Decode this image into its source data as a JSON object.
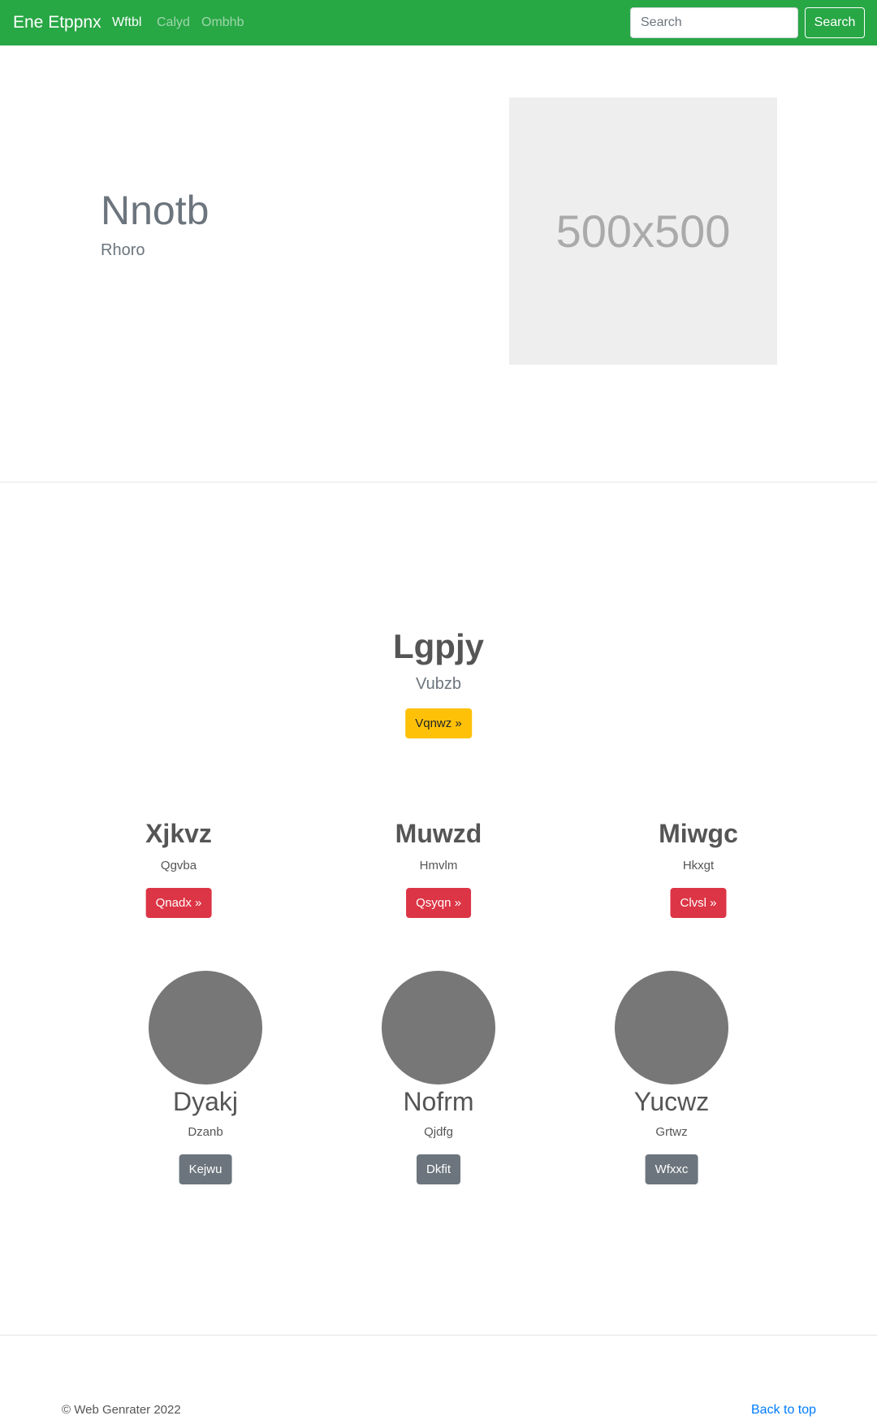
{
  "navbar": {
    "brand": "Ene Etppnx",
    "links": [
      "Wftbl",
      "Calyd",
      "Ombhb"
    ],
    "search_placeholder": "Search",
    "search_button": "Search",
    "bg_color": "#28a745"
  },
  "hero": {
    "title": "Nnotb",
    "subtitle": "Rhoro",
    "image_label": "500x500"
  },
  "feature": {
    "title": "Lgpjy",
    "subtitle": "Vubzb",
    "button": "Vqnwz »"
  },
  "columns": [
    {
      "title": "Xjkvz",
      "subtitle": "Qgvba",
      "button": "Qnadx »"
    },
    {
      "title": "Muwzd",
      "subtitle": "Hmvlm",
      "button": "Qsyqn »"
    },
    {
      "title": "Miwgc",
      "subtitle": "Hkxgt",
      "button": "Clvsl »"
    }
  ],
  "profiles": [
    {
      "name": "Dyakj",
      "subtitle": "Dzanb",
      "button": "Kejwu"
    },
    {
      "name": "Nofrm",
      "subtitle": "Qjdfg",
      "button": "Dkfit"
    },
    {
      "name": "Yucwz",
      "subtitle": "Grtwz",
      "button": "Wfxxc"
    }
  ],
  "footer": {
    "copyright": "© Web Genrater 2022",
    "back_to_top": "Back to top"
  }
}
